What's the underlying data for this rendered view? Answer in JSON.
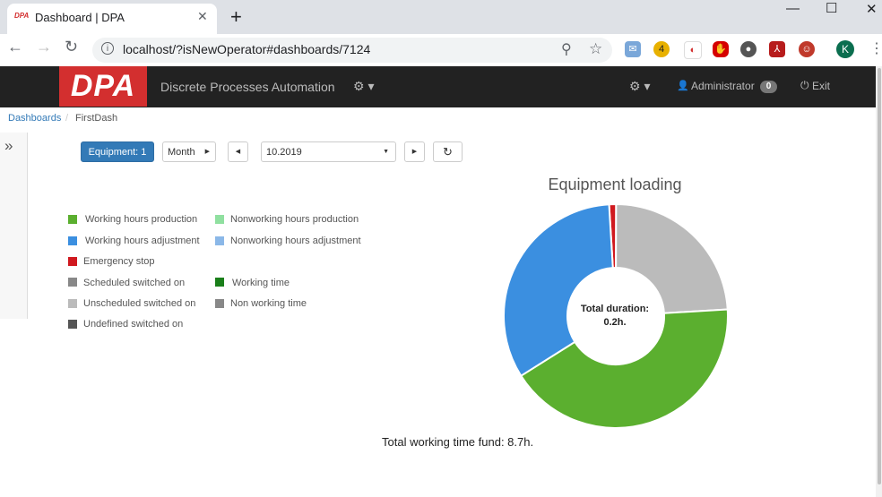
{
  "browser": {
    "tab_title": "Dashboard | DPA",
    "tab_logo": "DPA",
    "url": "localhost/?isNewOperator#dashboards/7124",
    "extension_badge": "4",
    "profile_initial": "K"
  },
  "navbar": {
    "logo_text": "DPA",
    "brand": "Discrete Processes Automation",
    "user": "Administrator",
    "user_badge": "0",
    "exit": "Exit"
  },
  "breadcrumb": {
    "root": "Dashboards",
    "current": "FirstDash"
  },
  "controls": {
    "equipment_label": "Equipment: 1",
    "period": "Month",
    "date_value": "10.2019"
  },
  "legend": {
    "left": [
      {
        "label": "Working hours production",
        "color": "#5baf2f"
      },
      {
        "label": "Working hours adjustment",
        "color": "#3b8fe0"
      },
      {
        "label": "Emergency stop",
        "color": "#d0191f"
      },
      {
        "label": "Scheduled switched on",
        "color": "#888888"
      },
      {
        "label": "Unscheduled switched on",
        "color": "#bbbbbb"
      },
      {
        "label": "Undefined switched on",
        "color": "#555555"
      }
    ],
    "right": [
      {
        "label": "Nonworking hours production",
        "color": "#90e0a0"
      },
      {
        "label": "Nonworking hours adjustment",
        "color": "#8bb8e8"
      },
      {
        "label": "Working time",
        "color": "#1a7f1a"
      },
      {
        "label": "Non working time",
        "color": "#888888"
      }
    ]
  },
  "chart_data": {
    "type": "pie",
    "title": "Equipment loading",
    "center_label": "Total duration:",
    "center_value": "0.2h.",
    "footer": "Total working time fund: 8.7h.",
    "slices": [
      {
        "name": "Emergency stop",
        "value": 1,
        "color": "#d0191f"
      },
      {
        "name": "Unscheduled switched on",
        "value": 24,
        "color": "#bbbbbb"
      },
      {
        "name": "Working hours production",
        "value": 42,
        "color": "#5baf2f"
      },
      {
        "name": "Working hours adjustment",
        "value": 33,
        "color": "#3b8fe0"
      }
    ]
  }
}
